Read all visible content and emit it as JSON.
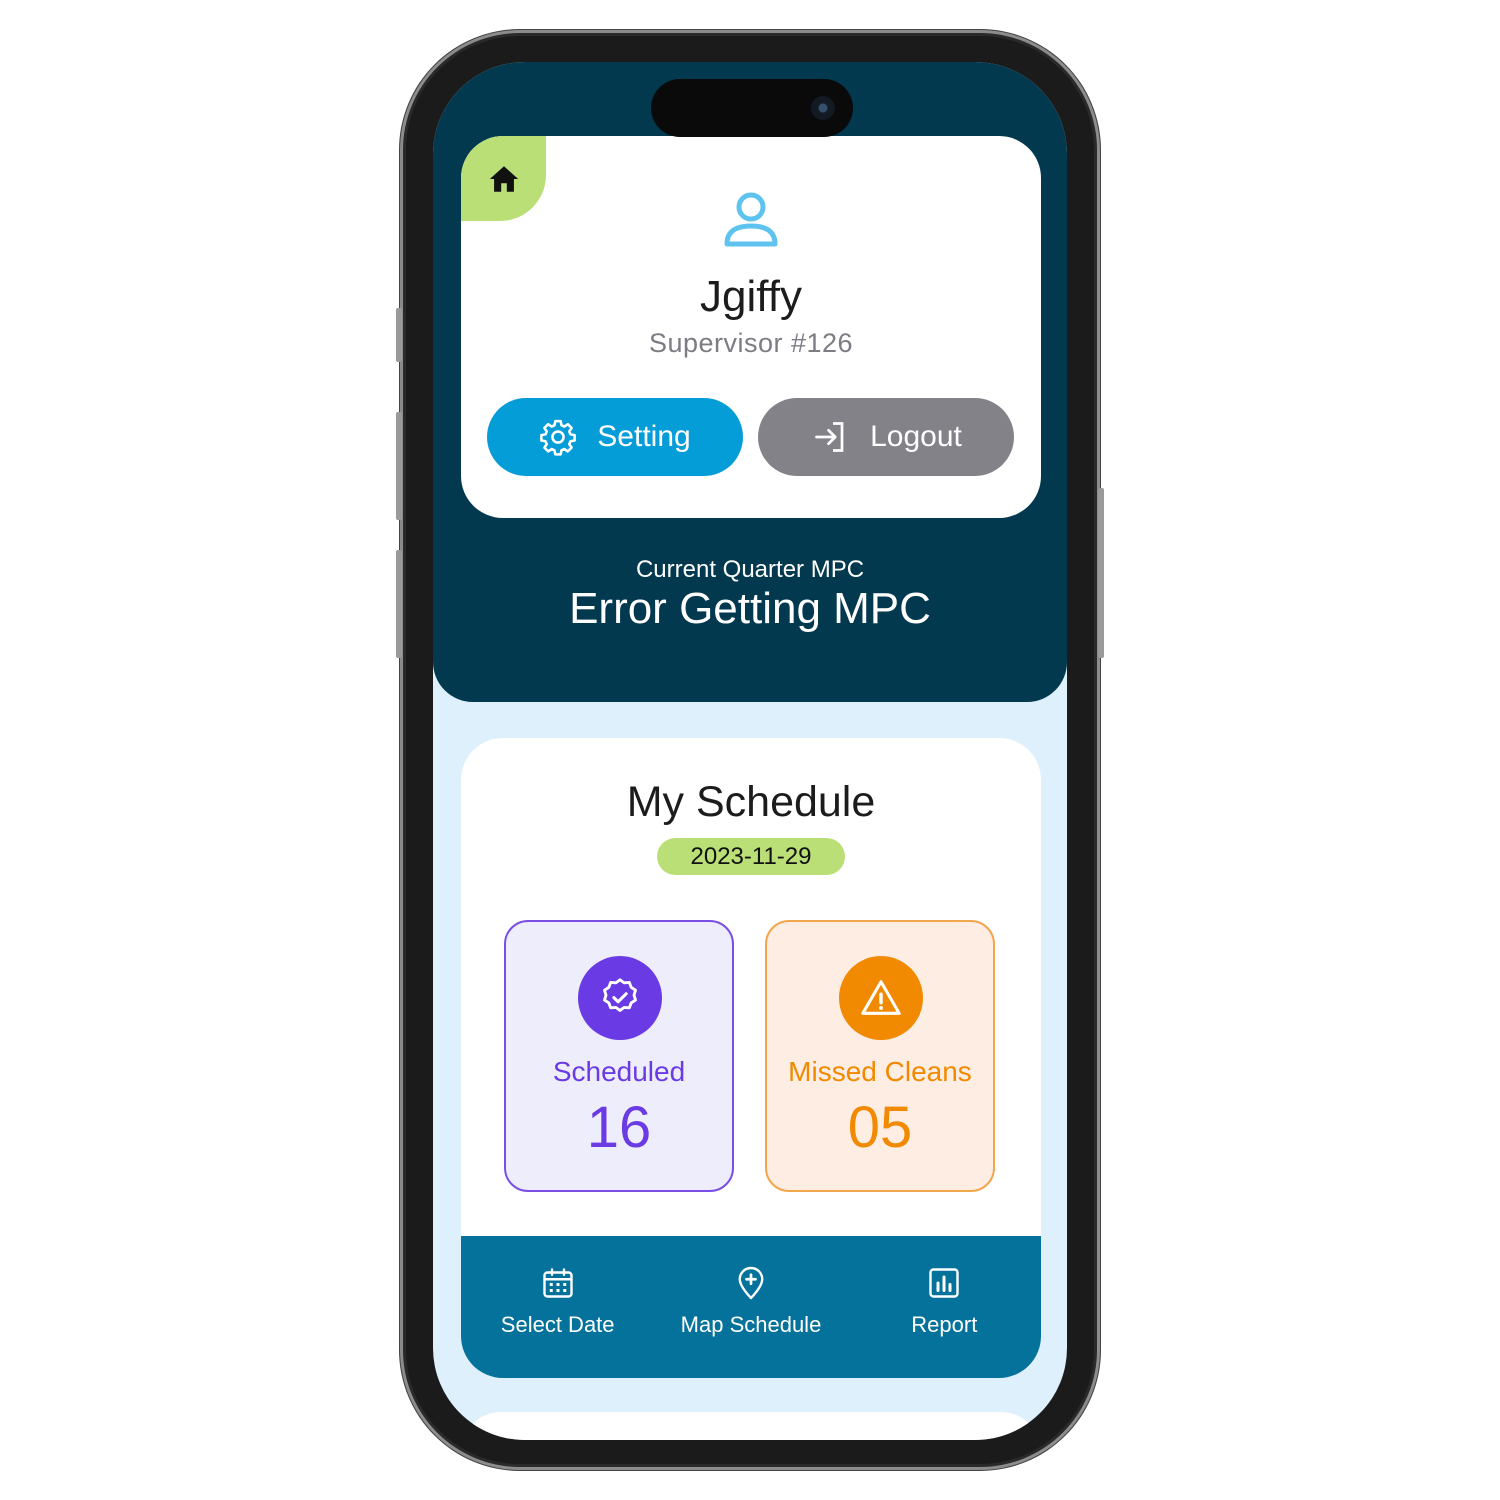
{
  "profile": {
    "home_icon": "home-icon",
    "user_icon": "user-icon",
    "name": "Jgiffy",
    "role": "Supervisor #126",
    "setting_label": "Setting",
    "setting_icon": "gear-icon",
    "logout_label": "Logout",
    "logout_icon": "login-arrow-icon"
  },
  "mpc": {
    "label": "Current Quarter MPC",
    "value": "Error Getting MPC"
  },
  "schedule": {
    "title": "My Schedule",
    "date": "2023-11-29",
    "stats": [
      {
        "label": "Scheduled",
        "value": "16",
        "icon": "verified-badge-icon",
        "color": "#6a3be4"
      },
      {
        "label": "Missed Cleans",
        "value": "05",
        "icon": "warning-triangle-icon",
        "color": "#f18a00"
      }
    ]
  },
  "nav": [
    {
      "label": "Select Date",
      "icon": "calendar-icon"
    },
    {
      "label": "Map Schedule",
      "icon": "map-pin-plus-icon"
    },
    {
      "label": "Report",
      "icon": "bar-chart-icon"
    }
  ],
  "colors": {
    "header_bg": "#03394e",
    "accent_green": "#badf76",
    "setting_blue": "#059dd8",
    "logout_gray": "#828288",
    "nav_bg": "#04729a",
    "page_bg": "#dff0fd"
  }
}
